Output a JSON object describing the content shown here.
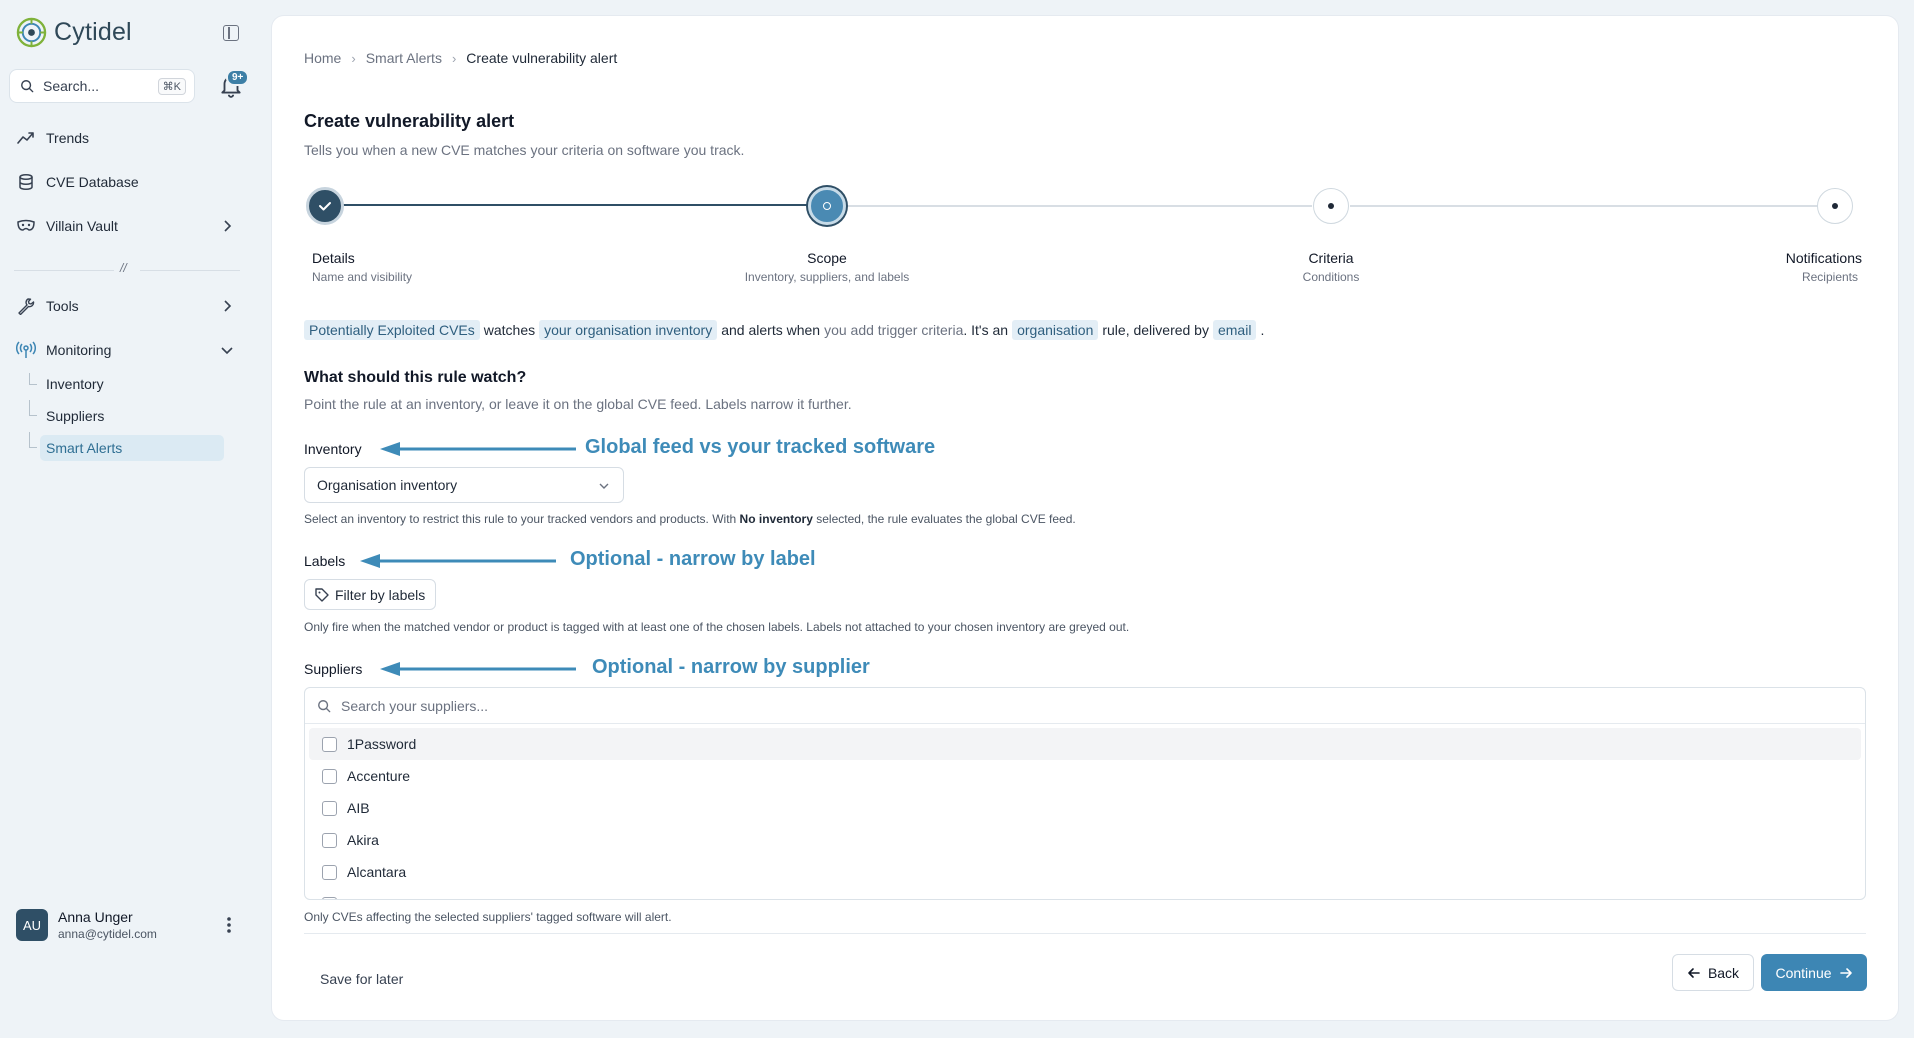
{
  "brand": {
    "name": "Cytidel"
  },
  "search": {
    "placeholder": "Search...",
    "shortcut": "⌘K"
  },
  "notifications": {
    "badge": "9+"
  },
  "sidebar": {
    "items": [
      {
        "label": "Trends"
      },
      {
        "label": "CVE Database"
      },
      {
        "label": "Villain Vault"
      },
      {
        "label": "Tools"
      },
      {
        "label": "Monitoring"
      }
    ],
    "separator": "//",
    "monitoring_sub": [
      {
        "label": "Inventory"
      },
      {
        "label": "Suppliers"
      },
      {
        "label": "Smart Alerts"
      }
    ]
  },
  "user": {
    "initials": "AU",
    "name": "Anna Unger",
    "email": "anna@cytidel.com"
  },
  "breadcrumb": [
    "Home",
    "Smart Alerts",
    "Create vulnerability alert"
  ],
  "page": {
    "title": "Create vulnerability alert",
    "subtitle": "Tells you when a new CVE matches your criteria on software you track."
  },
  "steps": [
    {
      "label": "Details",
      "desc": "Name and visibility",
      "state": "done"
    },
    {
      "label": "Scope",
      "desc": "Inventory, suppliers, and labels",
      "state": "active"
    },
    {
      "label": "Criteria",
      "desc": "Conditions",
      "state": "pending"
    },
    {
      "label": "Notifications",
      "desc": "Recipients",
      "state": "pending"
    }
  ],
  "summary": {
    "rule": "Potentially Exploited CVEs",
    "t1": "watches",
    "inventory": "your organisation inventory",
    "t2": "and alerts when",
    "t3": "you add trigger criteria",
    "t4": ". It's an",
    "scope": "organisation",
    "t5": "rule, delivered by",
    "channel": "email",
    "t6": "."
  },
  "section": {
    "title": "What should this rule watch?",
    "desc": "Point the rule at an inventory, or leave it on the global CVE feed. Labels narrow it further."
  },
  "inventory": {
    "label": "Inventory",
    "annotation": "Global feed vs your tracked software",
    "selected": "Organisation inventory",
    "help_a": "Select an inventory to restrict this rule to your tracked vendors and products. With",
    "help_b": "No inventory",
    "help_c": "selected, the rule evaluates the global CVE feed."
  },
  "labels": {
    "label": "Labels",
    "annotation": "Optional - narrow by label",
    "button": "Filter by labels",
    "help": "Only fire when the matched vendor or product is tagged with at least one of the chosen labels. Labels not attached to your chosen inventory are greyed out."
  },
  "suppliers": {
    "label": "Suppliers",
    "annotation": "Optional - narrow by supplier",
    "search_placeholder": "Search your suppliers...",
    "items": [
      "1Password",
      "Accenture",
      "AIB",
      "Akira",
      "Alcantara"
    ],
    "help": "Only CVEs affecting the selected suppliers' tagged software will alert."
  },
  "footer": {
    "save_later": "Save for later",
    "back": "Back",
    "continue": "Continue"
  },
  "colors": {
    "accent": "#3d86b4",
    "annotation": "#3e8bb8",
    "dark": "#2f4f66"
  }
}
